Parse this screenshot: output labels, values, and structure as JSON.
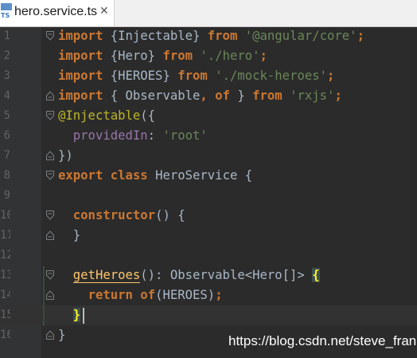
{
  "tab": {
    "icon_text": "TS",
    "title": "hero.service.ts",
    "close_glyph": "✕"
  },
  "colors": {
    "background": "#2b2b2b",
    "gutter": "#313335",
    "keyword": "#cc7832",
    "string": "#6a8759",
    "annotation": "#bbb529",
    "property": "#9876aa",
    "function": "#ffc66d",
    "text": "#a9b7c6"
  },
  "editor": {
    "lines": [
      {
        "num": "1",
        "tokens": [
          [
            "kw",
            "import"
          ],
          [
            "t",
            " {Injectable} "
          ],
          [
            "kw",
            "from"
          ],
          [
            "t",
            " "
          ],
          [
            "str",
            "'@angular/core'"
          ],
          [
            "kw",
            ";"
          ]
        ]
      },
      {
        "num": "2",
        "tokens": [
          [
            "kw",
            "import"
          ],
          [
            "t",
            " {Hero} "
          ],
          [
            "kw",
            "from"
          ],
          [
            "t",
            " "
          ],
          [
            "str",
            "'./hero'"
          ],
          [
            "kw",
            ";"
          ]
        ]
      },
      {
        "num": "3",
        "tokens": [
          [
            "kw",
            "import"
          ],
          [
            "t",
            " {HEROES} "
          ],
          [
            "kw",
            "from"
          ],
          [
            "t",
            " "
          ],
          [
            "str",
            "'./mock-heroes'"
          ],
          [
            "kw",
            ";"
          ]
        ]
      },
      {
        "num": "4",
        "tokens": [
          [
            "kw",
            "import"
          ],
          [
            "t",
            " { Observable"
          ],
          [
            "kw",
            ","
          ],
          [
            "t",
            " "
          ],
          [
            "kw",
            "of"
          ],
          [
            "t",
            " } "
          ],
          [
            "kw",
            "from"
          ],
          [
            "t",
            " "
          ],
          [
            "str",
            "'rxjs'"
          ],
          [
            "kw",
            ";"
          ]
        ]
      },
      {
        "num": "5",
        "tokens": [
          [
            "ann",
            "@Injectable"
          ],
          [
            "t",
            "({"
          ]
        ]
      },
      {
        "num": "6",
        "tokens": [
          [
            "t",
            "  "
          ],
          [
            "prop",
            "providedIn"
          ],
          [
            "t",
            ": "
          ],
          [
            "str",
            "'root'"
          ]
        ]
      },
      {
        "num": "7",
        "tokens": [
          [
            "t",
            "})"
          ]
        ]
      },
      {
        "num": "8",
        "tokens": [
          [
            "kw",
            "export"
          ],
          [
            "t",
            " "
          ],
          [
            "kw",
            "class"
          ],
          [
            "t",
            " HeroService {"
          ]
        ]
      },
      {
        "num": "9",
        "tokens": []
      },
      {
        "num": "10",
        "tokens": [
          [
            "t",
            "  "
          ],
          [
            "kw",
            "constructor"
          ],
          [
            "t",
            "() {"
          ]
        ]
      },
      {
        "num": "11",
        "tokens": [
          [
            "t",
            "  }"
          ]
        ]
      },
      {
        "num": "12",
        "tokens": []
      },
      {
        "num": "13",
        "tokens": [
          [
            "t",
            "  "
          ],
          [
            "fnu",
            "getHeroes"
          ],
          [
            "t",
            "(): Observable<Hero[]> "
          ],
          [
            "bm",
            "{"
          ]
        ]
      },
      {
        "num": "14",
        "tokens": [
          [
            "t",
            "    "
          ],
          [
            "kw",
            "return"
          ],
          [
            "t",
            " "
          ],
          [
            "kw",
            "of"
          ],
          [
            "t",
            "(HEROES)"
          ],
          [
            "kw",
            ";"
          ]
        ]
      },
      {
        "num": "15",
        "tokens": [
          [
            "t",
            "  "
          ],
          [
            "bm",
            "}"
          ]
        ]
      },
      {
        "num": "16",
        "tokens": [
          [
            "t",
            "}"
          ]
        ]
      }
    ]
  },
  "watermark": "https://blog.csdn.net/steve_frank"
}
